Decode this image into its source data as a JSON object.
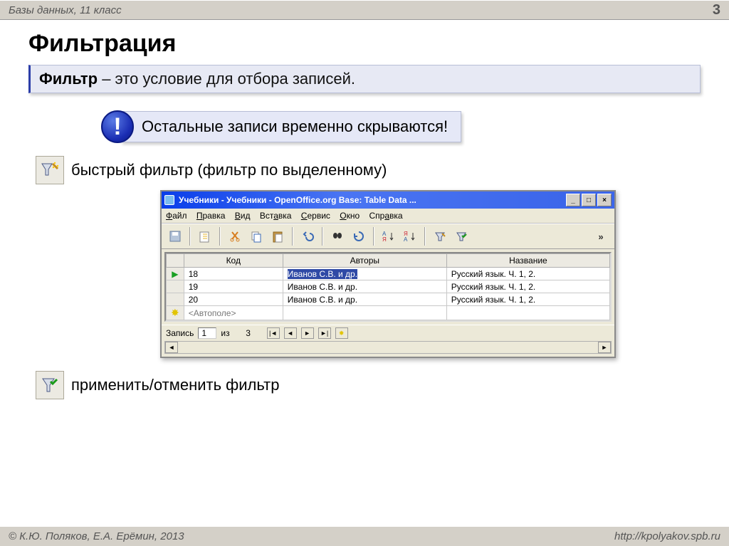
{
  "header": {
    "subject": "Базы данных, 11 класс",
    "pageNum": "3"
  },
  "title": "Фильтрация",
  "definition": {
    "term": "Фильтр",
    "rest": " – это условие для отбора записей."
  },
  "alert": {
    "badge": "!",
    "text": "Остальные записи временно скрываются!"
  },
  "bullet1": "быстрый фильтр (фильтр по выделенному)",
  "bullet2": "применить/отменить фильтр",
  "app": {
    "title": "Учебники - Учебники - OpenOffice.org Base: Table Data ...",
    "menu": [
      "Файл",
      "Правка",
      "Вид",
      "Вставка",
      "Сервис",
      "Окно",
      "Справка"
    ],
    "columns": [
      "Код",
      "Авторы",
      "Название"
    ],
    "rows": [
      {
        "marker": "arrow",
        "code": "18",
        "author": "Иванов С.В. и др.",
        "title": "Русский язык. Ч. 1, 2.",
        "sel": true
      },
      {
        "marker": "",
        "code": "19",
        "author": "Иванов С.В. и др.",
        "title": "Русский язык. Ч. 1, 2.",
        "sel": false
      },
      {
        "marker": "",
        "code": "20",
        "author": "Иванов С.В. и др.",
        "title": "Русский язык. Ч. 1, 2.",
        "sel": false
      },
      {
        "marker": "star",
        "code": "<Автополе>",
        "author": "",
        "title": "",
        "sel": false
      }
    ],
    "status": {
      "label": "Запись",
      "current": "1",
      "of": "из",
      "total": "3"
    }
  },
  "footer": {
    "authors": "© К.Ю. Поляков, Е.А. Ерёмин, 2013",
    "url": "http://kpolyakov.spb.ru"
  }
}
